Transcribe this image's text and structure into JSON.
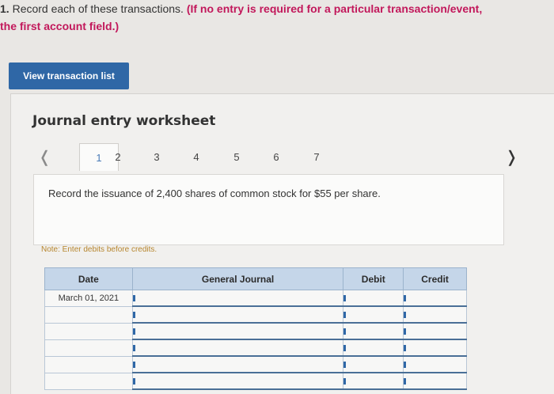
{
  "instructions": {
    "number": "1.",
    "plain": "Record each of these transactions.",
    "emphasis_line1": "(If no entry is required for a particular transaction/event,",
    "emphasis_line2": "the first account field.)"
  },
  "view_button": {
    "label": "View transaction list"
  },
  "worksheet": {
    "title": "Journal entry worksheet",
    "prev_icon": "chevron-left-icon",
    "next_icon": "chevron-right-icon",
    "tabs": [
      "1",
      "2",
      "3",
      "4",
      "5",
      "6",
      "7"
    ],
    "active_tab": "1",
    "task_text": "Record the issuance of 2,400 shares of common stock for $55 per share.",
    "note": "Note: Enter debits before credits."
  },
  "journal_table": {
    "headers": {
      "date": "Date",
      "account": "General Journal",
      "debit": "Debit",
      "credit": "Credit"
    },
    "rows": [
      {
        "date": "March 01, 2021",
        "account": "",
        "debit": "",
        "credit": ""
      },
      {
        "date": "",
        "account": "",
        "debit": "",
        "credit": ""
      },
      {
        "date": "",
        "account": "",
        "debit": "",
        "credit": ""
      },
      {
        "date": "",
        "account": "",
        "debit": "",
        "credit": ""
      },
      {
        "date": "",
        "account": "",
        "debit": "",
        "credit": ""
      },
      {
        "date": "",
        "account": "",
        "debit": "",
        "credit": ""
      }
    ]
  },
  "colors": {
    "accent": "#2f67a6",
    "emphasis": "#c2185b",
    "note": "#b7862f",
    "header_bg": "#c5d6e9"
  }
}
